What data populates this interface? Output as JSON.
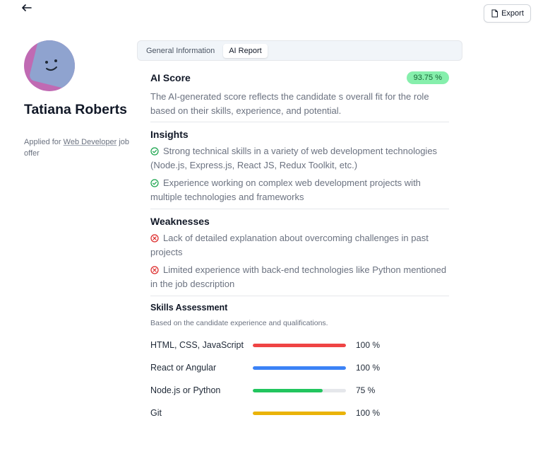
{
  "header": {
    "back_icon": "arrow-left-icon",
    "export_label": "Export",
    "export_icon": "file-icon"
  },
  "candidate": {
    "name": "Tatiana Roberts",
    "applied_prefix": "Applied for",
    "job_title": "Web Developer",
    "applied_suffix": "job offer"
  },
  "tabs": [
    {
      "label": "General Information",
      "active": false
    },
    {
      "label": "AI Report",
      "active": true
    }
  ],
  "ai_score": {
    "title": "AI Score",
    "value": "93.75 %",
    "badge_color": "#86efac",
    "description": "The AI-generated score reflects the candidate s overall fit for the role based on their skills, experience, and potential."
  },
  "insights": {
    "title": "Insights",
    "icon": "check-circle-icon",
    "icon_color": "#16a34a",
    "items": [
      "Strong technical skills in a variety of web development technologies (Node.js, Express.js, React JS, Redux Toolkit, etc.)",
      "Experience working on complex web development projects with multiple technologies and frameworks"
    ]
  },
  "weaknesses": {
    "title": "Weaknesses",
    "icon": "x-circle-icon",
    "icon_color": "#dc2626",
    "items": [
      "Lack of detailed explanation about overcoming challenges in past projects",
      "Limited experience with back-end technologies like Python mentioned in the job description"
    ]
  },
  "skills": {
    "title": "Skills Assessment",
    "subtitle": "Based on the candidate experience and qualifications.",
    "items": [
      {
        "name": "HTML, CSS, JavaScript",
        "percent": 100,
        "label": "100 %",
        "color": "#ef4444"
      },
      {
        "name": "React or Angular",
        "percent": 100,
        "label": "100 %",
        "color": "#3b82f6"
      },
      {
        "name": "Node.js or Python",
        "percent": 75,
        "label": "75 %",
        "color": "#22c55e"
      },
      {
        "name": "Git",
        "percent": 100,
        "label": "100 %",
        "color": "#eab308"
      }
    ]
  }
}
